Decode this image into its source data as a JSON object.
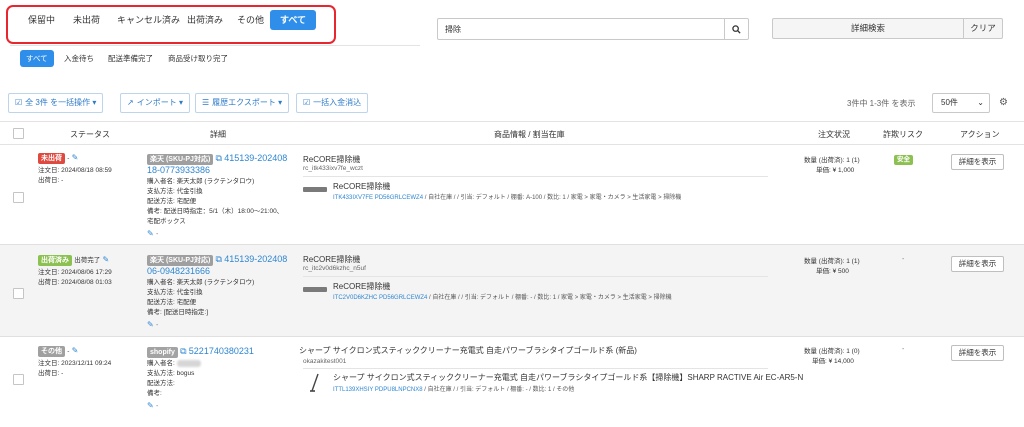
{
  "status_tabs": [
    {
      "label": "保留中"
    },
    {
      "label": "未出荷"
    },
    {
      "label": "キャンセル済み"
    },
    {
      "label": "出荷済み"
    },
    {
      "label": "その他"
    },
    {
      "label": "すべて"
    }
  ],
  "sub_tabs": [
    {
      "label": "すべて"
    },
    {
      "label": "入金待ち"
    },
    {
      "label": "配送準備完了"
    },
    {
      "label": "商品受け取り完了"
    }
  ],
  "search": {
    "value": "掃除",
    "icon": "search-icon"
  },
  "adv_search_label": "詳細検索",
  "clear_label": "クリア",
  "toolbar": {
    "bulk_label": "全 3件 を一括操作",
    "import_label": "インポート",
    "export_label": "履歴エクスポート",
    "payment_label": "一括入金消込"
  },
  "result_count": "3件中 1-3件 を表示",
  "per_page": "50件",
  "table_headers": {
    "status": "ステータス",
    "detail": "詳細",
    "product": "商品情報 / 割当在庫",
    "order_status": "注文状況",
    "fraud": "詐欺リスク",
    "action": "アクション"
  },
  "orders": [
    {
      "status_badge": "未出荷",
      "status_suffix": "-",
      "status_extra": "",
      "order_date": "注文日: 2024/08/18 08:59",
      "ship_date": "出荷日: -",
      "shop_badge": "楽天 (SKU-PJ対応)",
      "order_id": "415139-202408 18-0773933386",
      "order_id_1": "415139-202408",
      "order_id_2": "18-0773933386",
      "buyer": "購入者名: 楽天太郎 (ラクテンタロウ)",
      "payment": "支払方法: 代金引換",
      "shipping": "配送方法: 宅配便",
      "note_1": "備考: 配送日時指定：5/1（木）18:00～21:00、",
      "note_2": "宅配ボックス",
      "note_extra": "",
      "product_title": "ReCORE掃除機",
      "product_code": "rc_itk433ixv7fe_wczt",
      "stock_title": "ReCORE掃除機",
      "stock_code": "ITK433IXV7FE",
      "stock_code2": "PD56GRLCEWZ4",
      "stock_rest": "/ 自社在庫 / / 引当: デフォルト / 棚番: A-100 / 数比: 1 / 家電 > 家電・カメラ > 生活家電 > 掃除機",
      "qty": "数量 (出荷済): 1 (1)",
      "price": "単価: ¥ 1,000",
      "risk": "安全",
      "action_label": "詳細を表示"
    },
    {
      "status_badge": "出荷済み",
      "status_suffix": "",
      "status_extra": "出荷完了",
      "order_date": "注文日: 2024/08/06 17:29",
      "ship_date": "出荷日: 2024/08/08 01:03",
      "shop_badge": "楽天 (SKU-PJ対応)",
      "order_id_1": "415139-202408",
      "order_id_2": "06-0948231666",
      "buyer": "購入者名: 楽天太郎 (ラクテンタロウ)",
      "payment": "支払方法: 代金引換",
      "shipping": "配送方法: 宅配便",
      "note_1": "備考: [配送日時指定:]",
      "note_2": "",
      "product_title": "ReCORE掃除機",
      "product_code": "rc_itc2v0d6kzhc_n5uf",
      "stock_title": "ReCORE掃除機",
      "stock_code": "ITC2V0D6KZHC",
      "stock_code2": "PD56GRLCEWZ4",
      "stock_rest": "/ 自社在庫 / / 引当: デフォルト / 棚番: - / 数比: 1 / 家電 > 家電・カメラ > 生活家電 > 掃除機",
      "qty": "数量 (出荷済): 1 (1)",
      "price": "単価: ¥ 500",
      "risk": "-",
      "action_label": "詳細を表示"
    },
    {
      "status_badge": "その他",
      "status_suffix": "-",
      "status_extra": "",
      "order_date": "注文日: 2023/12/11 09:24",
      "ship_date": "出荷日: -",
      "shop_badge": "shopify",
      "order_id_1": "5221740380231",
      "buyer": "購入者名:",
      "payment": "支払方法: bogus",
      "shipping": "配送方法:",
      "note_1": "備考:",
      "product_title": "シャープ サイクロン式スティッククリーナー充電式 自走パワーブラシタイプゴールド系 (新品)",
      "product_code": "okazakitest001",
      "stock_title": "シャープ サイクロン式スティッククリーナー充電式 自走パワーブラシタイプゴールド系【掃除機】SHARP RACTIVE Air EC-AR5-N",
      "stock_code": "ITTL139XHSIY",
      "stock_code2": "PDPU8LNPCNX8",
      "stock_rest": "/ 自社在庫 / / 引当: デフォルト / 棚番: - / 数比: 1 / その他",
      "qty": "数量 (出荷済): 1 (0)",
      "price": "単価: ¥ 14,000",
      "risk": "-",
      "action_label": "詳細を表示"
    }
  ]
}
